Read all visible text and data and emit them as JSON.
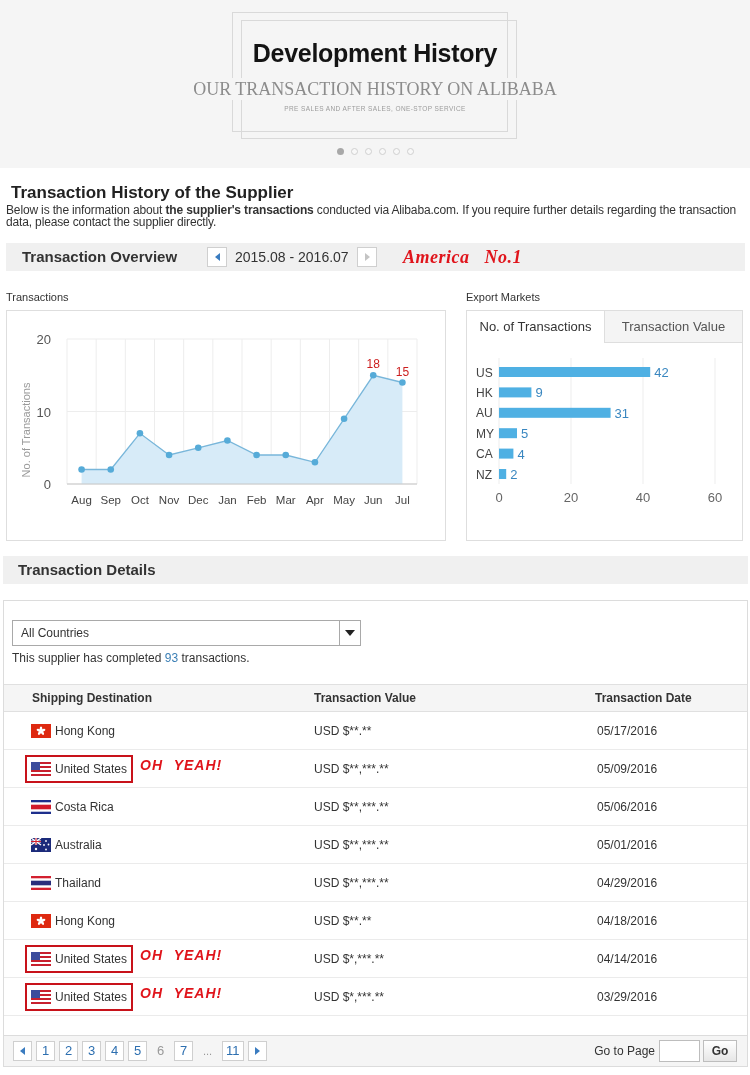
{
  "banner": {
    "title": "Development History",
    "subtitle": "OUR TRANSACTION HISTORY ON ALIBABA",
    "tagline": "PRE SALES AND AFTER SALES, ONE-STOP SERVICE",
    "slides": [
      {
        "selected": true
      },
      {
        "selected": false
      },
      {
        "selected": false
      },
      {
        "selected": false
      },
      {
        "selected": false
      },
      {
        "selected": false
      }
    ]
  },
  "heading": "Transaction History of the Supplier",
  "intro": "Below is the information about **the supplier's transactions** conducted via Alibaba.com. If you require further details regarding the transaction data, please contact the supplier directly.",
  "overview": {
    "title": "Transaction Overview",
    "period": "2015.08 - 2016.07",
    "prev_disabled": false,
    "next_disabled": true,
    "note": "America No.1"
  },
  "transactions_chart": {
    "label": "Transactions",
    "chart_data": {
      "type": "area",
      "ylabel": "No. of Transactions",
      "categories": [
        "Aug",
        "Sep",
        "Oct",
        "Nov",
        "Dec",
        "Jan",
        "Feb",
        "Mar",
        "Apr",
        "May",
        "Jun",
        "Jul"
      ],
      "values": [
        2,
        2,
        7,
        4,
        5,
        6,
        4,
        4,
        3,
        9,
        15,
        14
      ],
      "ylim": [
        0,
        20
      ],
      "yticks": [
        0,
        10,
        20
      ],
      "annotations": [
        "18",
        "15"
      ]
    }
  },
  "export_markets": {
    "label": "Export Markets",
    "tabs": [
      {
        "label": "No. of Transactions",
        "selected": true
      },
      {
        "label": "Transaction Value",
        "selected": false
      }
    ],
    "chart_data": {
      "type": "bar",
      "orientation": "horizontal",
      "categories": [
        "US",
        "HK",
        "AU",
        "MY",
        "CA",
        "NZ"
      ],
      "values": [
        42,
        9,
        31,
        5,
        4,
        2
      ],
      "xlim": [
        0,
        60
      ],
      "xticks": [
        0,
        20,
        40,
        60
      ],
      "data_labels": true,
      "value_labels": [
        "42",
        "9",
        "31",
        "5",
        "4",
        "2"
      ]
    }
  },
  "details": {
    "title": "Transaction Details",
    "filter": {
      "value": "All Countries"
    },
    "summary": {
      "before": "This supplier has completed",
      "count": "93",
      "after": "transactions."
    },
    "table": {
      "columns": [
        "Shipping Destination",
        "Transaction Value",
        "Transaction Date"
      ],
      "rows": [
        {
          "kind": "hk",
          "destination": "Hong Kong",
          "value": "USD $**.**",
          "date": "05/17/2016",
          "highlighted": false
        },
        {
          "kind": "us",
          "destination": "United States",
          "value": "USD $**,***.**",
          "date": "05/09/2016",
          "highlighted": true,
          "note": "OH YEAH!"
        },
        {
          "kind": "cr",
          "destination": "Costa Rica",
          "value": "USD $**,***.**",
          "date": "05/06/2016",
          "highlighted": false
        },
        {
          "kind": "au",
          "destination": "Australia",
          "value": "USD $**,***.**",
          "date": "05/01/2016",
          "highlighted": false
        },
        {
          "kind": "th",
          "destination": "Thailand",
          "value": "USD $**,***.**",
          "date": "04/29/2016",
          "highlighted": false
        },
        {
          "kind": "hk",
          "destination": "Hong Kong",
          "value": "USD $**.**",
          "date": "04/18/2016",
          "highlighted": false
        },
        {
          "kind": "us",
          "destination": "United States",
          "value": "USD $*,***.**",
          "date": "04/14/2016",
          "highlighted": true,
          "note": "OH YEAH!"
        },
        {
          "kind": "us",
          "destination": "United States",
          "value": "USD $*,***.**",
          "date": "03/29/2016",
          "highlighted": true,
          "note": "OH YEAH!"
        }
      ]
    },
    "pagination": {
      "pages": [
        {
          "kind": "page",
          "label": "1",
          "selected": false
        },
        {
          "kind": "page",
          "label": "2",
          "selected": false
        },
        {
          "kind": "page",
          "label": "3",
          "selected": false
        },
        {
          "kind": "page",
          "label": "4",
          "selected": false
        },
        {
          "kind": "page",
          "label": "5",
          "selected": false
        },
        {
          "kind": "page",
          "label": "6",
          "selected": true
        },
        {
          "kind": "page",
          "label": "7",
          "selected": false
        },
        {
          "kind": "ellipsis",
          "label": "...",
          "selected": false
        },
        {
          "kind": "page",
          "label": "11",
          "selected": false
        }
      ],
      "goto_label": "Go to Page",
      "go_button": "Go"
    }
  }
}
